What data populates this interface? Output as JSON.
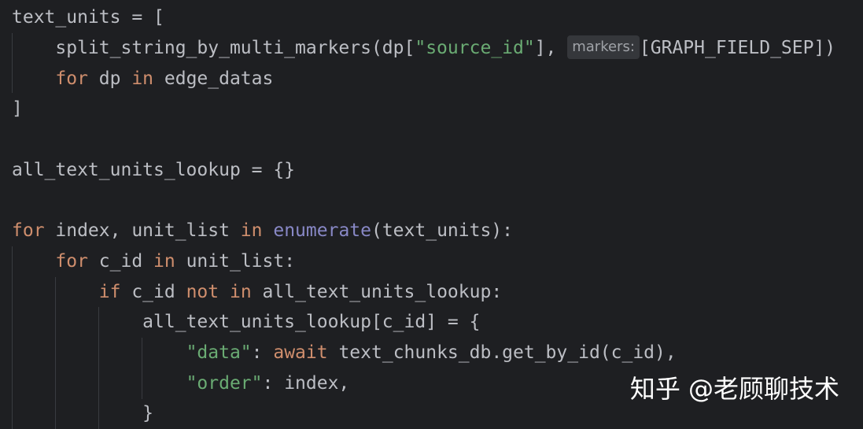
{
  "code": {
    "l1": {
      "a": "text_units = ["
    },
    "l2": {
      "a": "    split_string_by_multi_markers(dp[",
      "s": "\"source_id\"",
      "b": "], ",
      "hint": "markers:",
      "c": "[GRAPH_FIELD_SEP])"
    },
    "l3": {
      "pad": "    ",
      "k1": "for",
      "a": " dp ",
      "k2": "in",
      "b": " edge_datas"
    },
    "l4": {
      "a": "]"
    },
    "l6": {
      "a": "all_text_units_lookup = {}"
    },
    "l8": {
      "k1": "for",
      "a": " index, unit_list ",
      "k2": "in",
      "sp": " ",
      "fn": "enumerate",
      "b": "(text_units):"
    },
    "l9": {
      "pad": "    ",
      "k1": "for",
      "a": " c_id ",
      "k2": "in",
      "b": " unit_list:"
    },
    "l10": {
      "pad": "        ",
      "k1": "if",
      "a": " c_id ",
      "k2": "not",
      "sp": " ",
      "k3": "in",
      "b": " all_text_units_lookup:"
    },
    "l11": {
      "a": "            all_text_units_lookup[c_id] = {"
    },
    "l12": {
      "pad": "                ",
      "s": "\"data\"",
      "a": ": ",
      "k1": "await",
      "b": " text_chunks_db.get_by_id(c_id),"
    },
    "l13": {
      "pad": "                ",
      "s": "\"order\"",
      "a": ": index,"
    },
    "l14": {
      "a": "            }"
    }
  },
  "watermark": "知乎 @老顾聊技术",
  "colors": {
    "background": "#1e1f22",
    "text": "#bcbec4",
    "keyword": "#cf8e6d",
    "string": "#6aab73",
    "builtin": "#8888c6",
    "inlay_hint_bg": "#35373b"
  }
}
